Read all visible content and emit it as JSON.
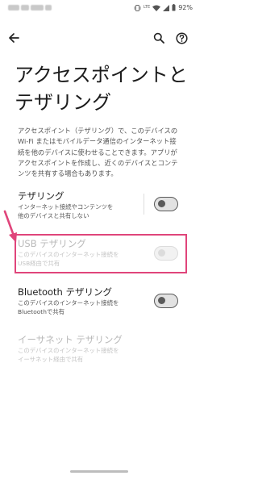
{
  "status_bar": {
    "network": "LTE",
    "battery": "92%"
  },
  "toolbar": {
    "back_icon": "back-arrow-icon",
    "search_icon": "search-icon",
    "help_icon": "help-icon"
  },
  "page": {
    "title_line1": "アクセスポイントと",
    "title_line2": "テザリング",
    "description": "アクセスポイント（テザリング）で、このデバイスのWi-Fi またはモバイルデータ通信のインターネット接続を他のデバイスに使わせることできます。アプリがアクセスポイントを作成し、近くのデバイスとコンテンツを共有する場合もあります。"
  },
  "settings": [
    {
      "title": "テザリング",
      "summary_line1": "インターネット接続やコンテンツを",
      "summary_line2": "他のデバイスと共有しない",
      "enabled": true,
      "checked": false
    },
    {
      "title": "USB テザリング",
      "summary_line1": "このデバイスのインターネット接続を",
      "summary_line2": "USB経由で共有",
      "enabled": false,
      "checked": false
    },
    {
      "title": "Bluetooth テザリング",
      "summary_line1": "このデバイスのインターネット接続を",
      "summary_line2": "Bluetoothで共有",
      "enabled": true,
      "checked": false
    },
    {
      "title": "イーサネット テザリング",
      "summary_line1": "このデバイスのインターネット接続を",
      "summary_line2": "イーサネット経由で共有",
      "enabled": false,
      "checked": false
    }
  ],
  "annotation": {
    "highlight_color": "#e0457b"
  }
}
